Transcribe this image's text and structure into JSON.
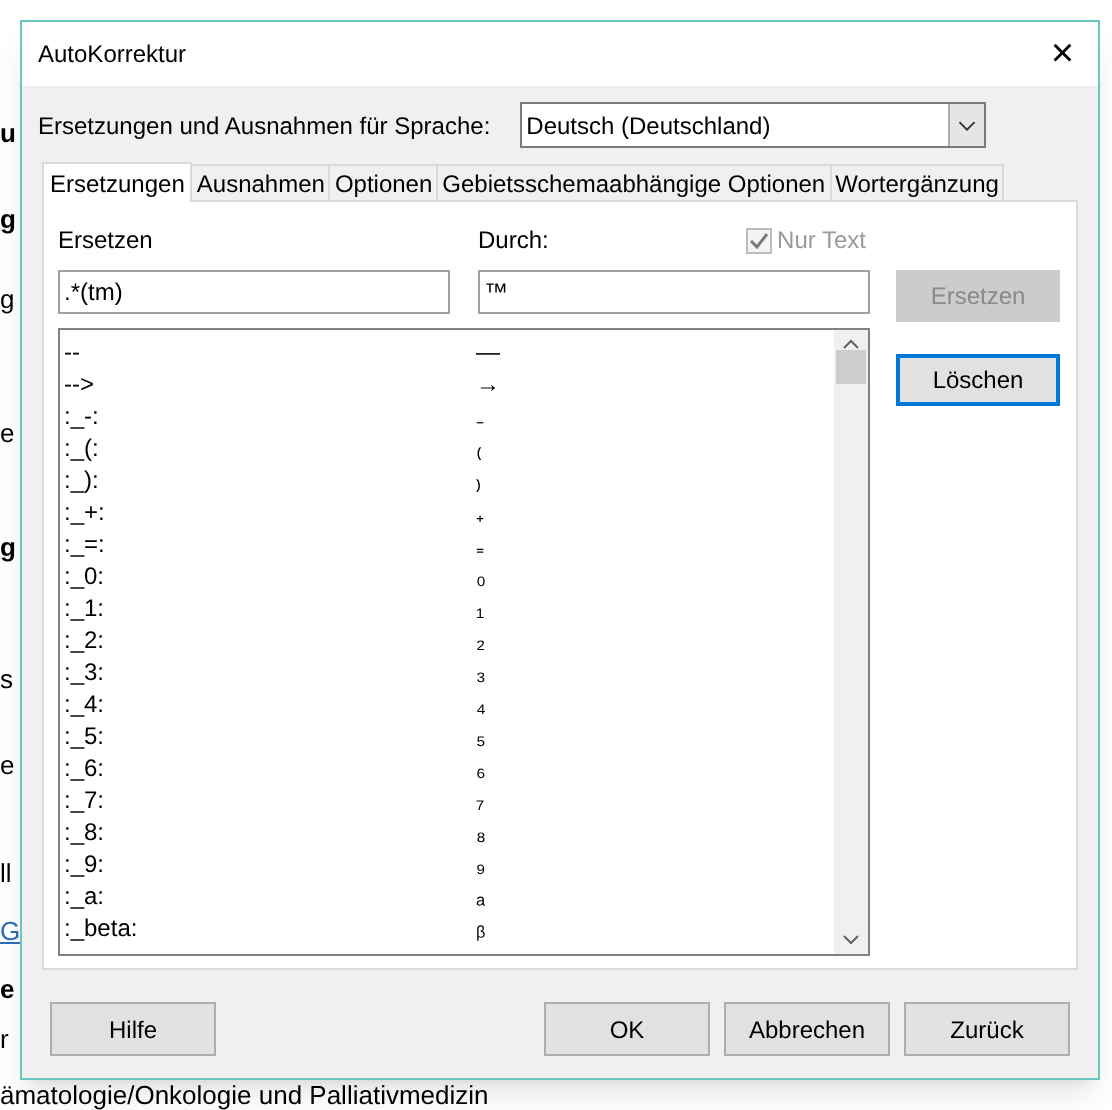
{
  "background_document": [
    {
      "kind": "heading",
      "text": "u"
    },
    {
      "kind": "heading",
      "text": "g"
    },
    {
      "kind": "text",
      "text": "g"
    },
    {
      "kind": "text",
      "text": "e"
    },
    {
      "kind": "heading",
      "text": "g"
    },
    {
      "kind": "text",
      "text": "s"
    },
    {
      "kind": "text",
      "text": "e"
    },
    {
      "kind": "text",
      "text": "ll"
    },
    {
      "kind": "link",
      "text": "G"
    },
    {
      "kind": "heading",
      "text": "e"
    },
    {
      "kind": "text",
      "text": "r"
    },
    {
      "kind": "text",
      "text": "ämatologie/Onkologie und Palliativmedizin"
    }
  ],
  "window": {
    "title": "AutoKorrektur",
    "close": "×"
  },
  "language": {
    "label": "Ersetzungen und Ausnahmen für Sprache:",
    "value": "Deutsch (Deutschland)"
  },
  "tabs": [
    {
      "label": "Ersetzungen",
      "selected": true
    },
    {
      "label": "Ausnahmen",
      "selected": false
    },
    {
      "label": "Optionen",
      "selected": false
    },
    {
      "label": "Gebietsschemaabhängige Optionen",
      "selected": false
    },
    {
      "label": "Wortergänzung",
      "selected": false
    }
  ],
  "replace": {
    "label": "Ersetzen",
    "value": ".*(tm)"
  },
  "with": {
    "label": "Durch:",
    "value": "™"
  },
  "text_only": {
    "label": "Nur Text",
    "checked": true,
    "disabled": true
  },
  "side_buttons": [
    {
      "label": "Ersetzen",
      "disabled": true,
      "focused": false
    },
    {
      "label": "Löschen",
      "disabled": false,
      "focused": true
    }
  ],
  "table": {
    "rows": [
      {
        "from": "--",
        "to": "—"
      },
      {
        "from": "-->",
        "to": "→"
      },
      {
        "from": ":_-:",
        "to": "₋"
      },
      {
        "from": ":_(:",
        "to": "₍"
      },
      {
        "from": ":_):",
        "to": "₎"
      },
      {
        "from": ":_+:",
        "to": "₊"
      },
      {
        "from": ":_=:",
        "to": "₌"
      },
      {
        "from": ":_0:",
        "to": "₀"
      },
      {
        "from": ":_1:",
        "to": "₁"
      },
      {
        "from": ":_2:",
        "to": "₂"
      },
      {
        "from": ":_3:",
        "to": "₃"
      },
      {
        "from": ":_4:",
        "to": "₄"
      },
      {
        "from": ":_5:",
        "to": "₅"
      },
      {
        "from": ":_6:",
        "to": "₆"
      },
      {
        "from": ":_7:",
        "to": "₇"
      },
      {
        "from": ":_8:",
        "to": "₈"
      },
      {
        "from": ":_9:",
        "to": "₉"
      },
      {
        "from": ":_a:",
        "to": "ₐ"
      },
      {
        "from": ":_beta:",
        "to": "ᵦ"
      }
    ]
  },
  "buttons": [
    {
      "label": "Hilfe"
    },
    {
      "label": "OK"
    },
    {
      "label": "Abbrechen"
    },
    {
      "label": "Zurück"
    }
  ]
}
